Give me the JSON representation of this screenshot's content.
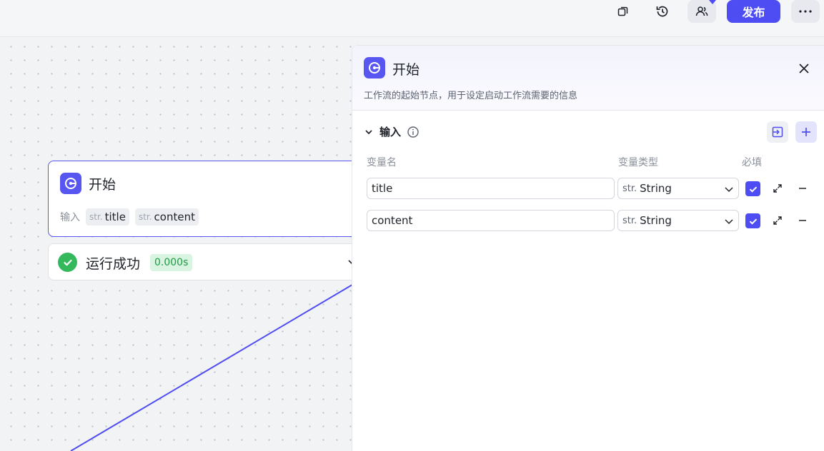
{
  "toolbar": {
    "icons": [
      "copy-icon",
      "history-icon",
      "collaborators-icon",
      "more-icon"
    ],
    "publish_label": "发布",
    "accent": "#4e4df3"
  },
  "node": {
    "title": "开始",
    "inputs_label": "输入",
    "inputs": [
      {
        "type": "str.",
        "name": "title"
      },
      {
        "type": "str.",
        "name": "content"
      }
    ],
    "run_status": "运行成功",
    "run_time": "0.000s",
    "status_color": "#33b85c"
  },
  "panel": {
    "title": "开始",
    "description": "工作流的起始节点，用于设定启动工作流需要的信息",
    "section_title": "输入",
    "columns": {
      "name": "变量名",
      "type": "变量类型",
      "required": "必填"
    },
    "rows": [
      {
        "name": "title",
        "type_prefix": "str.",
        "type": "String",
        "required": true
      },
      {
        "name": "content",
        "type_prefix": "str.",
        "type": "String",
        "required": true
      }
    ]
  }
}
